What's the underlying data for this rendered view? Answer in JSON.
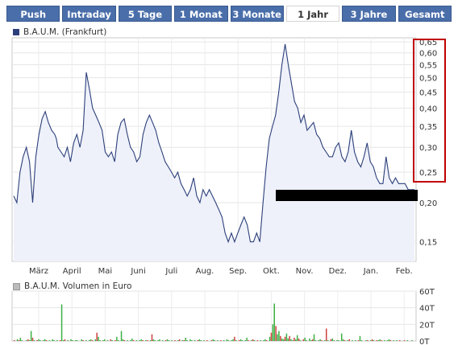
{
  "tabs": [
    {
      "label": "Push",
      "active": false
    },
    {
      "label": "Intraday",
      "active": false
    },
    {
      "label": "5 Tage",
      "active": false
    },
    {
      "label": "1 Monat",
      "active": false
    },
    {
      "label": "3 Monate",
      "active": false
    },
    {
      "label": "1 Jahr",
      "active": true
    },
    {
      "label": "3 Jahre",
      "active": false
    },
    {
      "label": "Gesamt",
      "active": false
    }
  ],
  "colors": {
    "tab_bg": "#4a6ea9",
    "line": "#2c3f7a",
    "fill": "#eef1fa",
    "volume_up": "#3cb043",
    "volume_down": "#d04040",
    "highlight_box": "#c00000",
    "redaction_bar": "#000000"
  },
  "chart_data": [
    {
      "type": "line",
      "legend": "B.A.U.M. (Frankfurt)",
      "x_tick_labels": [
        "März",
        "April",
        "Mai",
        "Juni",
        "Juli",
        "Aug.",
        "Sep.",
        "Okt.",
        "Nov.",
        "Dez.",
        "Jan.",
        "Feb."
      ],
      "y_tick_labels": [
        "0,65",
        "0,60",
        "0,55",
        "0,50",
        "0,45",
        "0,40",
        "0,35",
        "0,30",
        "0,25",
        "0,20",
        "0,15"
      ],
      "ylim": [
        0.13,
        0.67
      ],
      "grid": true,
      "y_scale": "log",
      "series": [
        {
          "name": "B.A.U.M. (Frankfurt)",
          "x": [
            0,
            2,
            4,
            6,
            8,
            10,
            12,
            14,
            16,
            18,
            20,
            22,
            24,
            26,
            27,
            28,
            30,
            32,
            34,
            36,
            38,
            40,
            42,
            44,
            46,
            48,
            50,
            52,
            54,
            56,
            58,
            60,
            62,
            64,
            66,
            68,
            70,
            72,
            74,
            76,
            78,
            80,
            82,
            84,
            86,
            88,
            90,
            92,
            94,
            96,
            98,
            100,
            102,
            104,
            106,
            108,
            110,
            112,
            114,
            116,
            118,
            120,
            122,
            124,
            126,
            128,
            130,
            132,
            134,
            136,
            138,
            140,
            142,
            144,
            146,
            148,
            150,
            152,
            154,
            156,
            158,
            160,
            162,
            164,
            166,
            168,
            170,
            172,
            174,
            176,
            178,
            180,
            182,
            184,
            186,
            188,
            190,
            192,
            194,
            196,
            198,
            200,
            202,
            204,
            206,
            208,
            210,
            212,
            214,
            216,
            218,
            220,
            222,
            224,
            226,
            228,
            230,
            232,
            234,
            236,
            238,
            240,
            242,
            244,
            246,
            248,
            250,
            252,
            254
          ],
          "y": [
            0.21,
            0.2,
            0.25,
            0.28,
            0.3,
            0.27,
            0.2,
            0.28,
            0.33,
            0.37,
            0.39,
            0.36,
            0.34,
            0.33,
            0.32,
            0.3,
            0.29,
            0.28,
            0.3,
            0.27,
            0.31,
            0.33,
            0.3,
            0.34,
            0.52,
            0.46,
            0.4,
            0.38,
            0.36,
            0.34,
            0.29,
            0.28,
            0.29,
            0.27,
            0.33,
            0.36,
            0.37,
            0.33,
            0.3,
            0.29,
            0.27,
            0.28,
            0.33,
            0.36,
            0.38,
            0.36,
            0.34,
            0.31,
            0.29,
            0.27,
            0.26,
            0.25,
            0.24,
            0.25,
            0.23,
            0.22,
            0.21,
            0.22,
            0.24,
            0.21,
            0.2,
            0.22,
            0.21,
            0.22,
            0.21,
            0.2,
            0.19,
            0.18,
            0.16,
            0.15,
            0.16,
            0.15,
            0.16,
            0.17,
            0.18,
            0.17,
            0.15,
            0.15,
            0.16,
            0.15,
            0.2,
            0.26,
            0.32,
            0.35,
            0.38,
            0.45,
            0.55,
            0.64,
            0.55,
            0.48,
            0.42,
            0.4,
            0.36,
            0.38,
            0.34,
            0.35,
            0.36,
            0.33,
            0.32,
            0.3,
            0.29,
            0.28,
            0.28,
            0.3,
            0.31,
            0.28,
            0.27,
            0.29,
            0.34,
            0.29,
            0.27,
            0.26,
            0.28,
            0.31,
            0.27,
            0.26,
            0.24,
            0.23,
            0.23,
            0.28,
            0.24,
            0.23,
            0.24,
            0.23,
            0.23,
            0.23,
            0.22,
            0.22,
            0.22
          ]
        }
      ]
    },
    {
      "type": "bar",
      "legend": "B.A.U.M. Volumen in Euro",
      "y_tick_labels": [
        "60T",
        "40T",
        "20T",
        "0T"
      ],
      "ylim": [
        0,
        60
      ],
      "values": [
        1,
        0,
        2,
        1,
        4,
        1,
        0,
        0,
        1,
        2,
        1,
        12,
        4,
        1,
        0,
        1,
        2,
        1,
        0,
        1,
        2,
        1,
        0,
        1,
        0,
        2,
        1,
        0,
        1,
        0,
        1,
        44,
        1,
        2,
        0,
        1,
        0,
        2,
        1,
        0,
        1,
        1,
        0,
        0,
        2,
        1,
        0,
        1,
        0,
        1,
        2,
        1,
        0,
        2,
        10,
        5,
        1,
        0,
        1,
        2,
        0,
        1,
        0,
        2,
        1,
        0,
        1,
        5,
        1,
        0,
        12,
        2,
        1,
        0,
        1,
        0,
        1,
        3,
        1,
        0,
        1,
        0,
        1,
        2,
        1,
        0,
        1,
        1,
        0,
        1,
        8,
        2,
        1,
        0,
        1,
        2,
        0,
        1,
        0,
        1,
        2,
        1,
        0,
        1,
        0,
        1,
        0,
        1,
        2,
        0,
        1,
        1,
        4,
        1,
        0,
        2,
        1,
        0,
        1,
        0,
        1,
        2,
        1,
        0,
        1,
        0,
        1,
        0,
        0,
        1,
        2,
        1,
        0,
        1,
        0,
        1,
        0,
        1,
        0,
        2,
        1,
        0,
        1,
        2,
        5,
        1,
        0,
        1,
        2,
        1,
        0,
        1,
        4,
        1,
        0,
        1,
        2,
        1,
        0,
        1,
        0,
        1,
        0,
        1,
        2,
        1,
        0,
        5,
        10,
        20,
        45,
        18,
        8,
        12,
        6,
        3,
        2,
        5,
        9,
        3,
        6,
        2,
        1,
        4,
        2,
        7,
        3,
        1,
        0,
        2,
        4,
        1,
        0,
        3,
        1,
        2,
        8,
        1,
        0,
        1,
        2,
        1,
        0,
        1,
        15,
        1,
        0,
        2,
        3,
        1,
        0,
        1,
        1,
        0,
        9,
        2,
        1,
        0,
        1,
        2,
        0,
        1,
        0,
        1,
        0,
        1,
        6,
        1,
        0,
        0,
        1,
        1,
        0,
        1,
        2,
        1,
        0,
        1,
        1,
        2,
        1,
        0,
        1,
        0,
        1,
        2,
        1,
        0,
        1,
        0,
        1,
        0,
        1,
        0,
        0,
        1,
        0,
        1,
        0,
        0,
        1,
        0
      ]
    }
  ]
}
